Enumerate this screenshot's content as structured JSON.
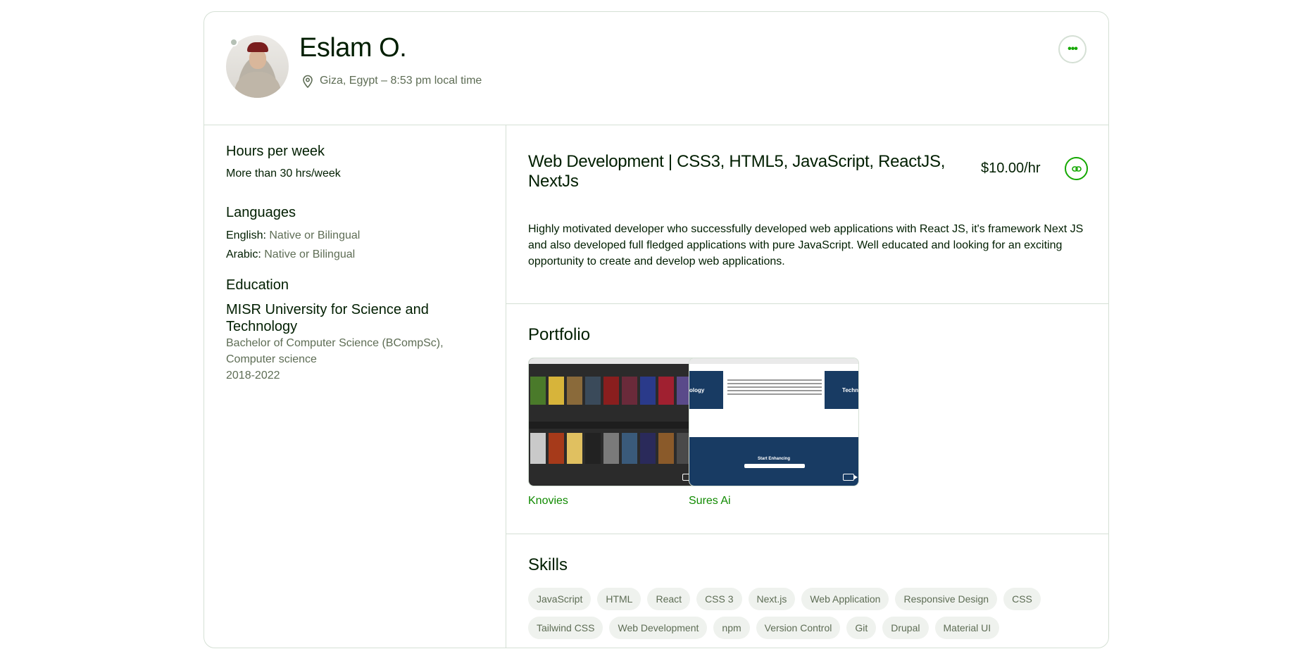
{
  "profile": {
    "name": "Eslam O.",
    "location": "Giza, Egypt – 8:53 pm local time"
  },
  "sidebar": {
    "hours": {
      "title": "Hours per week",
      "value": "More than 30 hrs/week"
    },
    "languages": {
      "title": "Languages",
      "items": [
        {
          "name": "English:",
          "level": "Native or Bilingual"
        },
        {
          "name": "Arabic:",
          "level": "Native or Bilingual"
        }
      ]
    },
    "education": {
      "title": "Education",
      "school": "MISR University for Science and Technology",
      "degree": "Bachelor of Computer Science (BCompSc), Computer science",
      "years": "2018-2022"
    }
  },
  "main": {
    "job_title": "Web Development | CSS3, HTML5, JavaScript, ReactJS, NextJs",
    "rate": "$10.00/hr",
    "overview": "Highly motivated developer who successfully developed web applications with React JS, it's framework Next JS and also developed full fledged applications with pure JavaScript. Well educated and looking for an exciting opportunity to create and develop web applications."
  },
  "portfolio": {
    "title": "Portfolio",
    "items": [
      {
        "title": "Knovies"
      },
      {
        "title": "Sures Ai",
        "thumb_left": "ology",
        "thumb_right": "Techn",
        "thumb_cta": "Start Enhancing"
      }
    ]
  },
  "skills": {
    "title": "Skills",
    "items": [
      "JavaScript",
      "HTML",
      "React",
      "CSS 3",
      "Next.js",
      "Web Application",
      "Responsive Design",
      "CSS",
      "Tailwind CSS",
      "Web Development",
      "npm",
      "Version Control",
      "Git",
      "Drupal",
      "Material UI"
    ]
  },
  "colors": {
    "brand_green": "#14a800",
    "link_green": "#108a00",
    "text": "#001e00",
    "muted": "#5e6d55",
    "chip_bg": "#eff2ee",
    "sures_blue": "#183b63"
  }
}
